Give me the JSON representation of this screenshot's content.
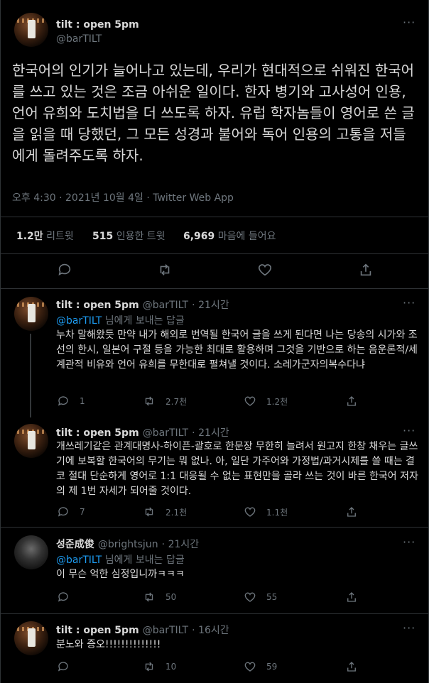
{
  "main_tweet": {
    "display_name": "tilt : open 5pm",
    "handle": "@barTILT",
    "text": "한국어의 인기가 늘어나고 있는데, 우리가 현대적으로 쉬워진 한국어를 쓰고 있는 것은 조금 아쉬운 일이다. 한자 병기와 고사성어 인용, 언어 유희와 도치법을 더 쓰도록 하자. 유럽 학자놈들이 영어로 쓴 글을 읽을 때 당했던, 그 모든 성경과 불어와 독어 인용의 고통을 저들에게 돌려주도록 하자.",
    "meta": "오후 4:30 · 2021년 10월 4일 · Twitter Web App",
    "retweets_count": "1.2만",
    "retweets_label": "리트윗",
    "quotes_count": "515",
    "quotes_label": "인용한 트윗",
    "likes_count": "6,969",
    "likes_label": "마음에 들어요",
    "more": "···"
  },
  "replies": [
    {
      "display_name": "tilt : open 5pm",
      "handle": "@barTILT",
      "time": "· 21시간",
      "reply_to_mention": "@barTILT",
      "reply_to_suffix": " 님에게 보내는 답글",
      "text": "누차 말해왔듯 만약 내가 해외로 번역될 한국어 글을 쓰게 된다면 나는 당송의 시가와 조선의 한시, 일본어 구절 등을 가능한 최대로 활용하며 그것을 기반으로 하는 음운론적/세계관적 비유와 언어 유희를 무한대로 펼쳐낼 것이다. 소레가군자의복수다냐",
      "replies": "1",
      "retweets": "2.7천",
      "likes": "1.2천",
      "more": "···"
    },
    {
      "display_name": "tilt : open 5pm",
      "handle": "@barTILT",
      "time": "· 21시간",
      "text": "개쓰레기같은 관계대명사-하이픈-괄호로 한문장 무한히 늘려서 원고지 한창 채우는 글쓰기에 보복할 한국어의 무기는 뭐 없나. 아, 일단 가주어와 가정법/과거시제를 쓸 때는 결코 절대 단순하게 영어로 1:1 대응될 수 없는 표현만을 골라 쓰는 것이 바른 한국어 저자의 제 1번 자세가 되어줄 것이다.",
      "replies": "7",
      "retweets": "2.1천",
      "likes": "1.1천",
      "more": "···"
    },
    {
      "display_name": "성준成俊",
      "handle": "@brightsjun",
      "time": "· 21시간",
      "reply_to_mention": "@barTILT",
      "reply_to_suffix": " 님에게 보내는 답글",
      "text": "이 무슨 억한 심정입니까ㅋㅋㅋ",
      "replies": "",
      "retweets": "50",
      "likes": "55",
      "more": "···"
    },
    {
      "display_name": "tilt : open 5pm",
      "handle": "@barTILT",
      "time": "· 16시간",
      "text": "분노와 증오!!!!!!!!!!!!!!",
      "replies": "",
      "retweets": "10",
      "likes": "59",
      "more": "···"
    }
  ]
}
